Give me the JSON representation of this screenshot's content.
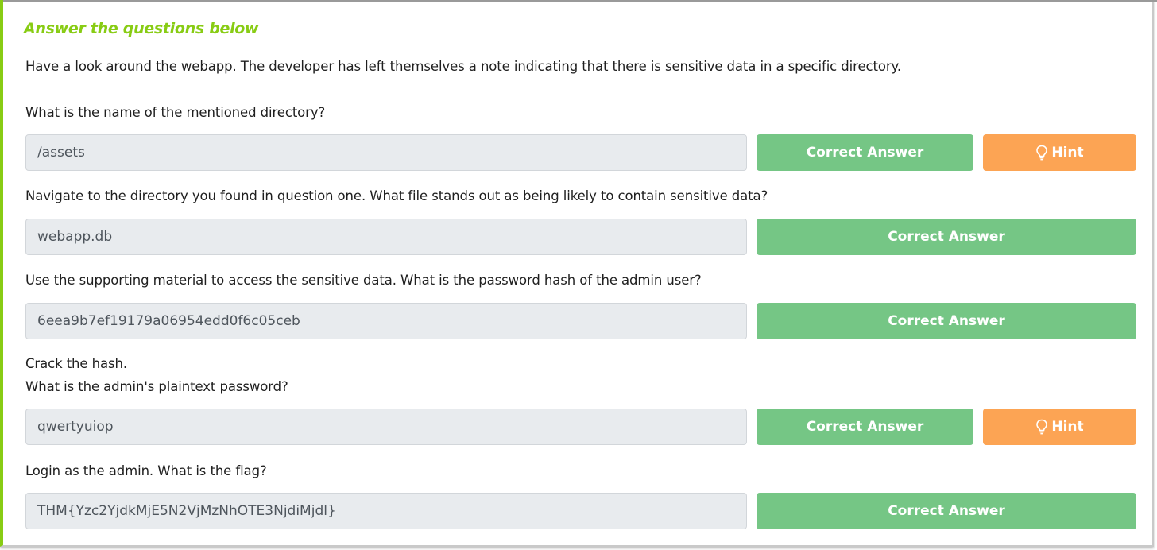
{
  "section": {
    "title": "Answer the questions below"
  },
  "intro": "Have a look around the webapp. The developer has left themselves a note indicating that there is sensitive data in a specific directory.",
  "questions": [
    {
      "text": "What is the name of the mentioned directory?",
      "answer": "/assets",
      "button": "Correct Answer",
      "hint": "Hint"
    },
    {
      "text": "Navigate to the directory you found in question one. What file stands out as being likely to contain sensitive data?",
      "answer": "webapp.db",
      "button": "Correct Answer"
    },
    {
      "text": "Use the supporting material to access the sensitive data. What is the password hash of the admin user?",
      "answer": "6eea9b7ef19179a06954edd0f6c05ceb",
      "button": "Correct Answer"
    },
    {
      "text_line1": "Crack the hash.",
      "text_line2": "What is the admin's plaintext password?",
      "answer": "qwertyuiop",
      "button": "Correct Answer",
      "hint": "Hint"
    },
    {
      "text": "Login as the admin. What is the flag?",
      "answer": "THM{Yzc2YjdkMjE5N2VjMzNhOTE3NjdiMjdl}",
      "button": "Correct Answer"
    }
  ],
  "colors": {
    "accent": "#88cc14",
    "correct": "#75c685",
    "hint": "#fca454",
    "field": "#e8ebee"
  },
  "icons": {
    "hint_icon": "lightbulb-icon"
  }
}
